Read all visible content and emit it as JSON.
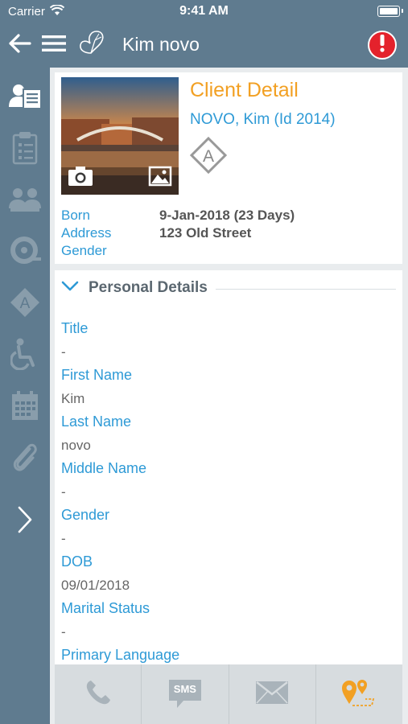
{
  "status_bar": {
    "carrier": "Carrier",
    "time": "9:41 AM"
  },
  "nav": {
    "title": "Kim novo",
    "icons": [
      "back-arrow-icon",
      "hamburger-menu-icon",
      "butterfly-logo-icon",
      "alert-icon"
    ],
    "alert_color": "#e4222c"
  },
  "side_rail": {
    "items": [
      "client-detail-icon",
      "checklist-icon",
      "people-icon",
      "alarm-bell-icon",
      "allergy-a-icon",
      "wheelchair-icon",
      "calendar-icon",
      "paperclip-icon",
      "chevron-right-icon"
    ]
  },
  "client": {
    "title": "Client Detail",
    "name_line": "NOVO, Kim (Id 2014)",
    "badge": "A",
    "born_label": "Born",
    "born_value": "9-Jan-2018 (23 Days)",
    "address_label": "Address",
    "address_value": "123 Old Street",
    "gender_label": "Gender"
  },
  "personal": {
    "heading": "Personal Details",
    "fields": [
      {
        "label": "Title",
        "value": "-"
      },
      {
        "label": "First Name",
        "value": "Kim"
      },
      {
        "label": "Last Name",
        "value": "novo"
      },
      {
        "label": "Middle Name",
        "value": "-"
      },
      {
        "label": "Gender",
        "value": "-"
      },
      {
        "label": "DOB",
        "value": "09/01/2018"
      },
      {
        "label": "Marital Status",
        "value": "-"
      },
      {
        "label": "Primary Language",
        "value": ""
      }
    ]
  },
  "toolbar": {
    "sms_label": "SMS",
    "icons": [
      "phone-icon",
      "sms-icon",
      "mail-icon",
      "map-route-icon"
    ]
  },
  "colors": {
    "header_bg": "#5f7b8f",
    "accent_orange": "#f2a023",
    "link_blue": "#2e9ad6"
  }
}
